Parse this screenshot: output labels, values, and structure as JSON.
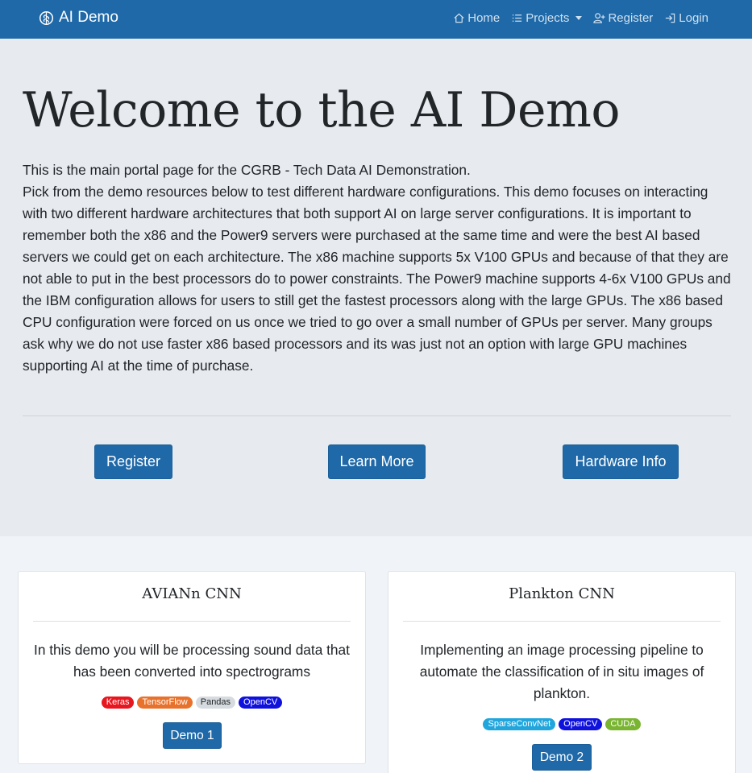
{
  "navbar": {
    "brand": "AI Demo",
    "brand_icon": "brain-icon",
    "links": [
      {
        "label": "Home",
        "icon": "home-icon"
      },
      {
        "label": "Projects",
        "icon": "list-icon"
      },
      {
        "label": "Register",
        "icon": "user-plus-icon"
      },
      {
        "label": "Login",
        "icon": "login-icon"
      }
    ]
  },
  "hero": {
    "title": "Welcome to the AI Demo",
    "paragraph_1": "This is the main portal page for the CGRB - Tech Data AI Demonstration.",
    "paragraph_2": "Pick from the demo resources below to test different hardware configurations. This demo focuses on interacting with two different hardware architectures that both support AI on large server configurations. It is important to remember both the x86 and the Power9 servers were purchased at the same time and were the best AI based servers we could get on each architecture. The x86 machine supports 5x V100 GPUs and because of that they are not able to put in the best processors do to power constraints. The Power9 machine supports 4-6x V100 GPUs and the IBM configuration allows for users to still get the fastest processors along with the large GPUs. The x86 based CPU configuration were forced on us once we tried to go over a small number of GPUs per server. Many groups ask why we do not use faster x86 based processors and its was just not an option with large GPU machines supporting AI at the time of purchase.",
    "buttons": {
      "register": "Register",
      "learn_more": "Learn More",
      "hardware_info": "Hardware Info"
    }
  },
  "cards": [
    {
      "title": "AVIANn CNN",
      "text": "In this demo you will be processing sound data that has been converted into spectrograms",
      "badges": [
        {
          "label": "Keras",
          "color": "#e8161f",
          "text_color": "#ffffff"
        },
        {
          "label": "TensorFlow",
          "color": "#e8722b",
          "text_color": "#ffffff"
        },
        {
          "label": "Pandas",
          "color": "#d6dbdf",
          "text_color": "#212529"
        },
        {
          "label": "OpenCV",
          "color": "#0f11dd",
          "text_color": "#ffffff"
        }
      ],
      "button": "Demo 1"
    },
    {
      "title": "Plankton CNN",
      "text": "Implementing an image processing pipeline to automate the classification of in situ images of plankton.",
      "badges": [
        {
          "label": "SparseConvNet",
          "color": "#20a6dd",
          "text_color": "#ffffff"
        },
        {
          "label": "OpenCV",
          "color": "#0f11dd",
          "text_color": "#ffffff"
        },
        {
          "label": "CUDA",
          "color": "#79b531",
          "text_color": "#ffffff"
        }
      ],
      "button": "Demo 2"
    }
  ],
  "colors": {
    "primary": "#1f69a8",
    "hero_background": "#e7ebef",
    "page_background": "#f0f3f7"
  }
}
